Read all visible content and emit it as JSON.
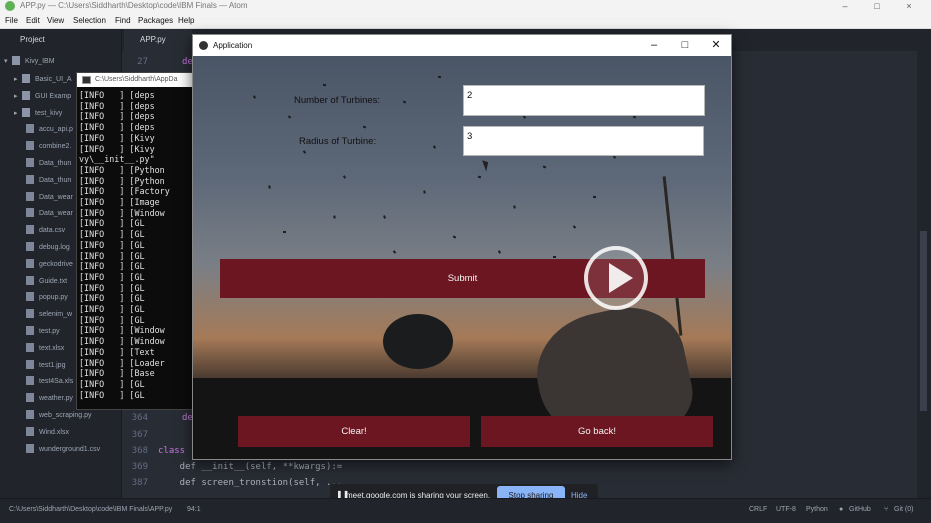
{
  "atom": {
    "title": "APP.py — C:\\Users\\Siddharth\\Desktop\\code\\IBM Finals — Atom",
    "menu": [
      "File",
      "Edit",
      "View",
      "Selection",
      "Find",
      "Packages",
      "Help"
    ],
    "tab_project": "Project",
    "tab_file": "APP.py",
    "window_controls": [
      "–",
      "□",
      "×"
    ]
  },
  "tree": {
    "root": "Kivy_IBM",
    "items": [
      {
        "label": "Basic_UI_A",
        "type": "folder"
      },
      {
        "label": "GUI Examp",
        "type": "folder"
      },
      {
        "label": "test_kivy",
        "type": "folder"
      },
      {
        "label": "accu_api.p",
        "type": "file"
      },
      {
        "label": "combine2.",
        "type": "file"
      },
      {
        "label": "Data_thun",
        "type": "file"
      },
      {
        "label": "Data_thun",
        "type": "file"
      },
      {
        "label": "Data_wear",
        "type": "file"
      },
      {
        "label": "Data_wear",
        "type": "file"
      },
      {
        "label": "data.csv",
        "type": "file"
      },
      {
        "label": "debug.log",
        "type": "file"
      },
      {
        "label": "geckodrive",
        "type": "file"
      },
      {
        "label": "Guide.txt",
        "type": "file"
      },
      {
        "label": "popup.py",
        "type": "file"
      },
      {
        "label": "selenim_w",
        "type": "file"
      },
      {
        "label": "test.py",
        "type": "file"
      },
      {
        "label": "text.xlsx",
        "type": "file"
      },
      {
        "label": "test1.jpg",
        "type": "file"
      },
      {
        "label": "test4Sa.xls",
        "type": "file"
      },
      {
        "label": "weather.py",
        "type": "file"
      },
      {
        "label": "web_scraping.py",
        "type": "file"
      },
      {
        "label": "Wind.xlsx",
        "type": "file"
      },
      {
        "label": "wunderground1.csv",
        "type": "file"
      }
    ]
  },
  "editor": {
    "lines": [
      {
        "num": "27",
        "code": "de"
      },
      {
        "num": "364",
        "code": "de"
      },
      {
        "num": "367",
        "code": ""
      },
      {
        "num": "368",
        "code": "class"
      },
      {
        "num": "369",
        "code": "    def __init__(self, **kwargs):="
      },
      {
        "num": "387",
        "code": "    def screen_tronstion(self, ..."
      },
      {
        "num": "",
        "code": "    def ..."
      }
    ]
  },
  "terminal": {
    "title": "C:\\Users\\Siddharth\\AppDa",
    "lines": [
      "[INFO   ] [deps",
      "[INFO   ] [deps",
      "[INFO   ] [deps",
      "[INFO   ] [deps",
      "[INFO   ] [Kivy",
      "[INFO   ] [Kivy",
      "vy\\__init__.py\"",
      "[INFO   ] [Python",
      "[INFO   ] [Python",
      "[INFO   ] [Factory",
      "[INFO   ] [Image",
      "[INFO   ] [Window",
      "[INFO   ] [GL",
      "[INFO   ] [GL",
      "[INFO   ] [GL",
      "[INFO   ] [GL",
      "[INFO   ] [GL",
      "[INFO   ] [GL",
      "[INFO   ] [GL",
      "[INFO   ] [GL",
      "[INFO   ] [GL",
      "[INFO   ] [GL",
      "[INFO   ] [Window",
      "[INFO   ] [Window",
      "[INFO   ] [Text",
      "[INFO   ] [Loader",
      "[INFO   ] [Base",
      "[INFO   ] [GL",
      "[INFO   ] [GL"
    ]
  },
  "app": {
    "title": "Application",
    "turbines_label": "Number of Turbines:",
    "turbines_value": "2",
    "radius_label": "Radius of Turbine:",
    "radius_value": "3",
    "submit": "Submit",
    "clear": "Clear!",
    "back": "Go back!",
    "controls": [
      "–",
      "□",
      "✕"
    ]
  },
  "share": {
    "message": "meet.google.com is sharing your screen.",
    "stop": "Stop sharing",
    "hide": "Hide"
  },
  "status": {
    "path": "C:\\Users\\Siddharth\\Desktop\\code\\IBM Finals\\APP.py",
    "position": "94:1",
    "line_ending": "CRLF",
    "encoding": "UTF-8",
    "grammar": "Python",
    "github": "GitHub",
    "git": "Git (0)"
  },
  "colors": {
    "button": "#6b1620",
    "stop_button": "#8ab4f8",
    "editor_bg": "#282c34"
  }
}
